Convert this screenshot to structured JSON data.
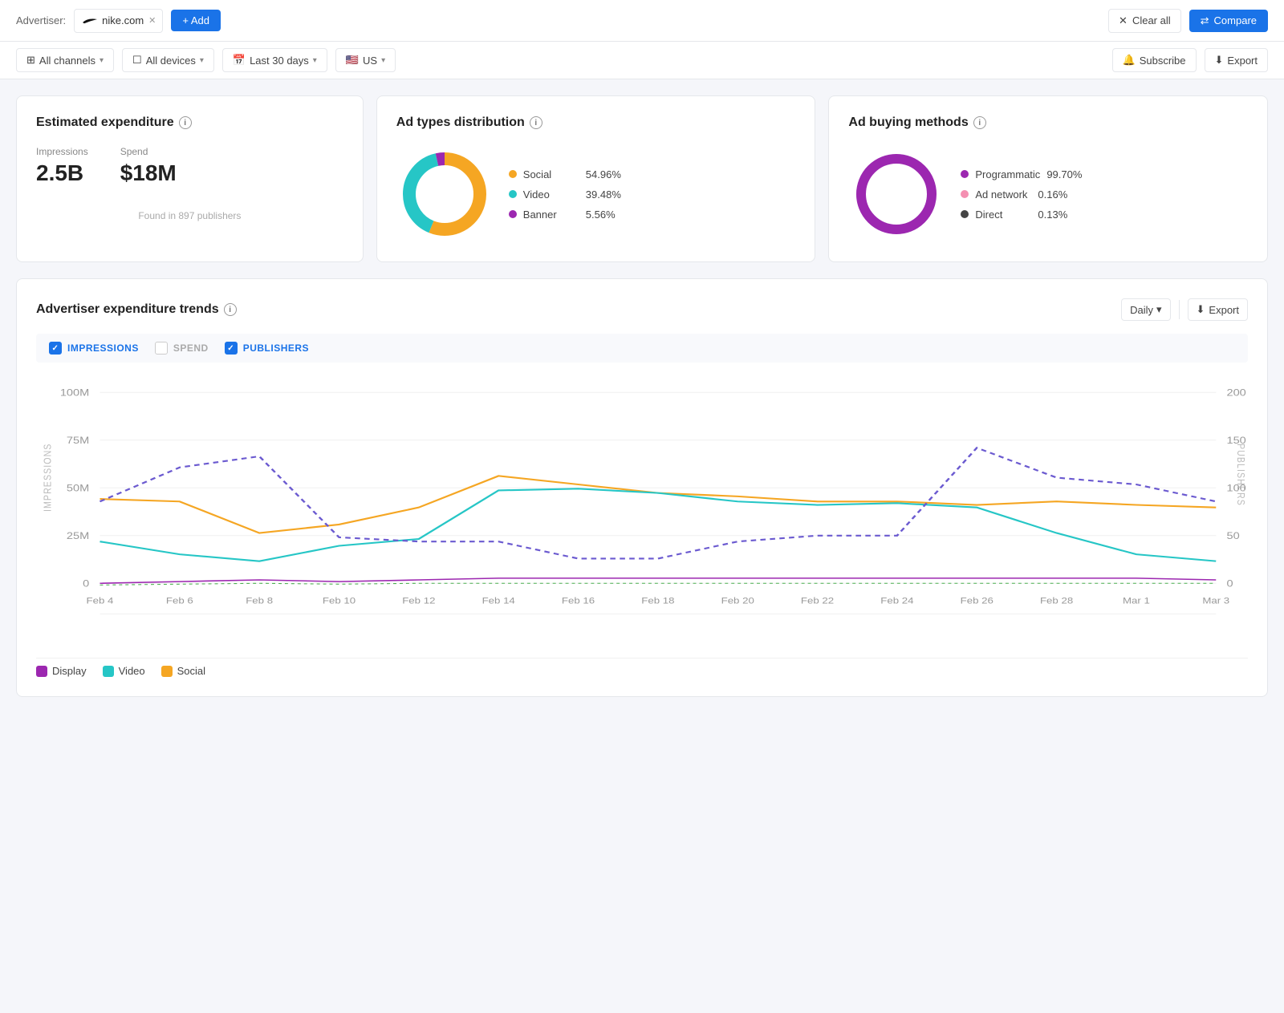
{
  "header": {
    "advertiser_label": "Advertiser:",
    "advertiser_name": "nike.com",
    "add_label": "+ Add",
    "clear_all_label": "Clear all",
    "compare_label": "Compare"
  },
  "filters": {
    "all_channels": "All channels",
    "all_devices": "All devices",
    "last_30_days": "Last 30 days",
    "country": "US",
    "subscribe": "Subscribe",
    "export": "Export"
  },
  "expenditure": {
    "title": "Estimated expenditure",
    "impressions_label": "Impressions",
    "impressions_value": "2.5B",
    "spend_label": "Spend",
    "spend_value": "$18M",
    "publishers_note": "Found in 897 publishers"
  },
  "ad_types": {
    "title": "Ad types distribution",
    "items": [
      {
        "label": "Social",
        "value": "54.96%",
        "color": "#f5a623",
        "pct": 54.96
      },
      {
        "label": "Video",
        "value": "39.48%",
        "color": "#26c6c6",
        "pct": 39.48
      },
      {
        "label": "Banner",
        "value": "5.56%",
        "color": "#9c27b0",
        "pct": 5.56
      }
    ]
  },
  "ad_buying": {
    "title": "Ad buying methods",
    "items": [
      {
        "label": "Programmatic",
        "value": "99.70%",
        "color": "#9c27b0",
        "pct": 99.7
      },
      {
        "label": "Ad network",
        "value": "0.16%",
        "color": "#f48fb1",
        "pct": 0.16
      },
      {
        "label": "Direct",
        "value": "0.13%",
        "color": "#444",
        "pct": 0.13
      }
    ]
  },
  "trends": {
    "title": "Advertiser expenditure trends",
    "daily_label": "Daily",
    "export_label": "Export",
    "checkboxes": {
      "impressions": "IMPRESSIONS",
      "spend": "SPEND",
      "publishers": "PUBLISHERS"
    },
    "y_left": [
      "100M",
      "75M",
      "50M",
      "25M",
      "0"
    ],
    "y_right": [
      "200",
      "150",
      "100",
      "50",
      "0"
    ],
    "x_labels": [
      "Feb 4",
      "Feb 6",
      "Feb 8",
      "Feb 10",
      "Feb 12",
      "Feb 14",
      "Feb 16",
      "Feb 18",
      "Feb 20",
      "Feb 22",
      "Feb 24",
      "Feb 26",
      "Feb 28",
      "Mar 1",
      "Mar 3"
    ],
    "y_axis_left_label": "IMPRESSIONS",
    "y_axis_right_label": "PUBLISHERS",
    "bottom_legend": [
      {
        "label": "Display",
        "color": "#9c27b0"
      },
      {
        "label": "Video",
        "color": "#26c6c6"
      },
      {
        "label": "Social",
        "color": "#f5a623"
      }
    ]
  }
}
